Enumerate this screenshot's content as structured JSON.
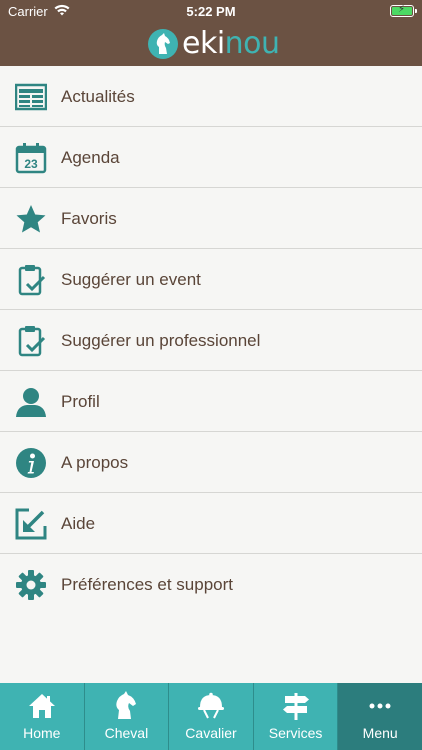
{
  "status_bar": {
    "carrier": "Carrier",
    "time": "5:22 PM"
  },
  "header": {
    "logo_prefix": "eki",
    "logo_suffix": "nou"
  },
  "menu": {
    "items": [
      {
        "label": "Actualités",
        "icon": "newspaper-icon"
      },
      {
        "label": "Agenda",
        "icon": "calendar-icon",
        "day": "23"
      },
      {
        "label": "Favoris",
        "icon": "star-icon"
      },
      {
        "label": "Suggérer un event",
        "icon": "clipboard-check-icon"
      },
      {
        "label": "Suggérer un professionnel",
        "icon": "clipboard-check-icon"
      },
      {
        "label": "Profil",
        "icon": "person-icon"
      },
      {
        "label": "A propos",
        "icon": "info-icon"
      },
      {
        "label": "Aide",
        "icon": "help-arrow-icon"
      },
      {
        "label": "Préférences et support",
        "icon": "gear-icon"
      }
    ]
  },
  "tabbar": {
    "tabs": [
      {
        "label": "Home",
        "icon": "house-icon"
      },
      {
        "label": "Cheval",
        "icon": "horse-icon"
      },
      {
        "label": "Cavalier",
        "icon": "riding-helmet-icon"
      },
      {
        "label": "Services",
        "icon": "signpost-icon"
      },
      {
        "label": "Menu",
        "icon": "more-icon"
      }
    ],
    "active": "Menu"
  },
  "colors": {
    "header_brown": "#6b5243",
    "teal": "#3fb3b2",
    "teal_dark": "#2c7d7d",
    "icon_teal": "#2f8582",
    "text_brown": "#5a4538",
    "background": "#f6f6f4"
  }
}
